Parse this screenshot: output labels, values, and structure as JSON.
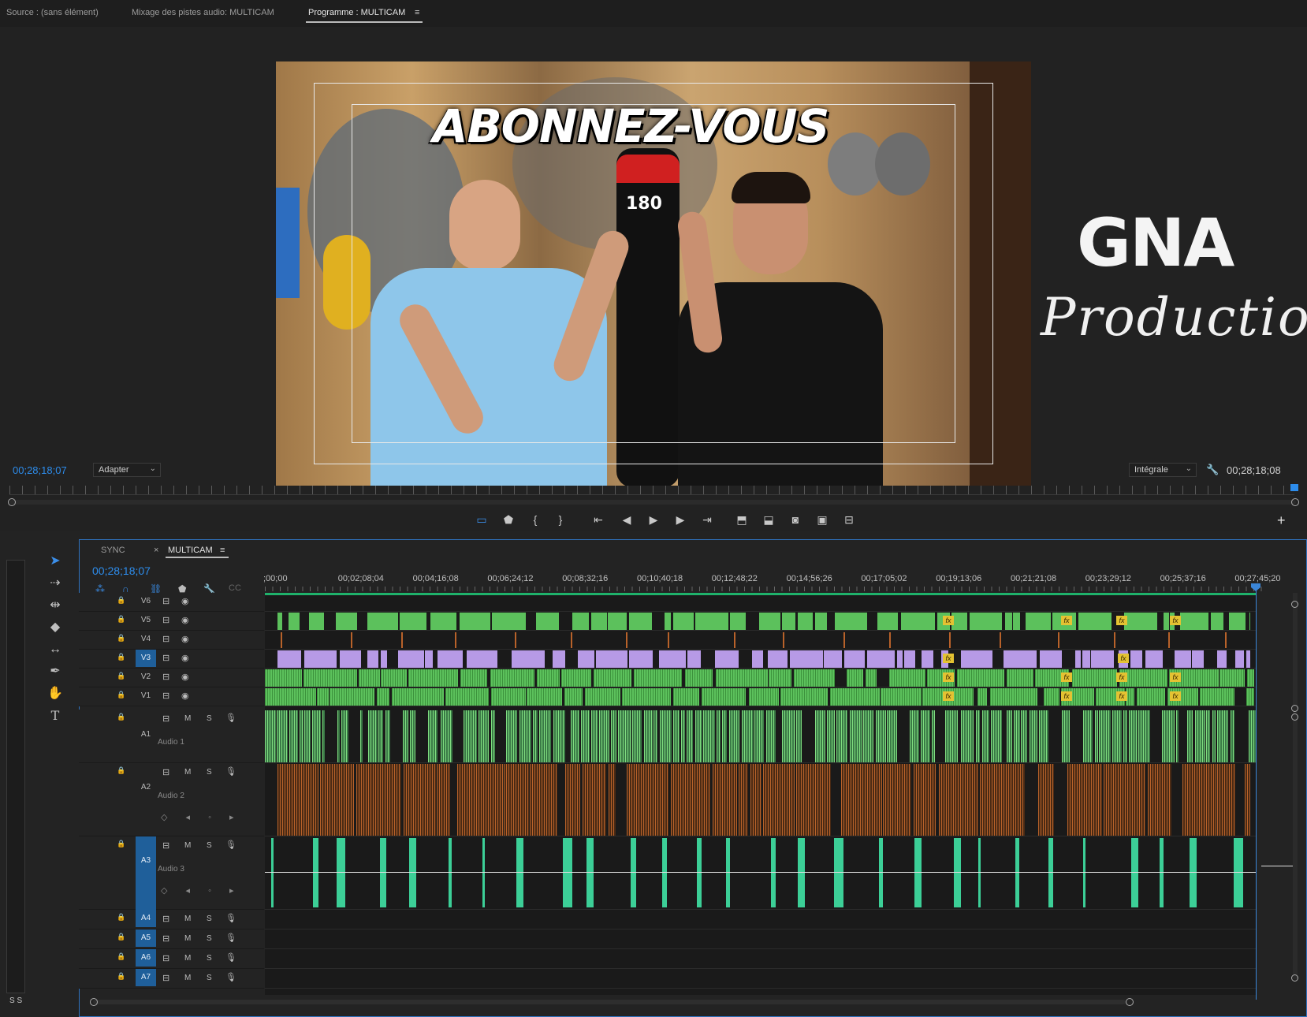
{
  "tabs": {
    "source": "Source : (sans élément)",
    "audio_mixer": "Mixage des pistes audio: MULTICAM",
    "program": "Programme : MULTICAM",
    "program_menu": "≡"
  },
  "program_monitor": {
    "overlay_title": "ABONNEZ-VOUS",
    "bag_number": "180",
    "logo_main": "GNA",
    "logo_script": "Production",
    "timecode_left": "00;28;18;07",
    "zoom": "Adapter",
    "resolution": "Intégrale",
    "timecode_right": "00;28;18;08"
  },
  "timeline": {
    "tab_sync": "SYNC",
    "tab_close": "×",
    "tab_multicam": "MULTICAM",
    "tab_menu": "≡",
    "timecode": "00;28;18;07",
    "ruler_labels": [
      ";00;00",
      "00;02;08;04",
      "00;04;16;08",
      "00;06;24;12",
      "00;08;32;16",
      "00;10;40;18",
      "00;12;48;22",
      "00;14;56;26",
      "00;17;05;02",
      "00;19;13;06",
      "00;21;21;08",
      "00;23;29;12",
      "00;25;37;16",
      "00;27;45;20"
    ],
    "video_tracks": [
      "V6",
      "V5",
      "V4",
      "V3",
      "V2",
      "V1"
    ],
    "audio_tracks": [
      {
        "id": "A1",
        "name": "Audio 1"
      },
      {
        "id": "A2",
        "name": "Audio 2"
      },
      {
        "id": "A3",
        "name": "Audio 3"
      },
      {
        "id": "A4",
        "name": ""
      },
      {
        "id": "A5",
        "name": ""
      },
      {
        "id": "A6",
        "name": ""
      },
      {
        "id": "A7",
        "name": ""
      }
    ],
    "mute": "M",
    "solo": "S",
    "fx": "fx",
    "meter_labels": "S S",
    "accent_colors": {
      "green": "#5cc15c",
      "purple": "#b79ae6",
      "orange": "#b8622a",
      "teal": "#3ccf97",
      "blue": "#2d8ceb"
    }
  }
}
